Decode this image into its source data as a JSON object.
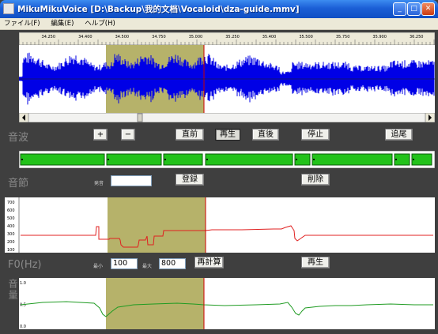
{
  "window": {
    "title": "MikuMikuVoice [D:\\Backup\\我的文档\\Vocaloid\\dza-guide.mmv]",
    "minimize": "_",
    "maximize": "□",
    "close": "✕"
  },
  "menu": [
    {
      "label": "ファイル(F)"
    },
    {
      "label": "編集(E)"
    },
    {
      "label": "ヘルプ(H)"
    }
  ],
  "ruler": {
    "ticks": [
      "34.250",
      "34.400",
      "34.500",
      "34.750",
      "35.000",
      "35.250",
      "35.400",
      "35.500",
      "35.750",
      "35.900",
      "36.250"
    ]
  },
  "colors": {
    "waveform": "#0000e6",
    "selection": "#b6b26a",
    "cursor": "#cc0000",
    "note": "#22c21a",
    "pitch": "#e02020",
    "volume": "#1f9b22"
  },
  "waveform": {
    "section_label": "音波",
    "zoom_in": "+",
    "zoom_out": "−",
    "prev": "直前",
    "play": "再生",
    "next": "直後",
    "stop": "停止",
    "end": "追尾"
  },
  "notes": {
    "section_label": "音節",
    "lyric_label": "発音",
    "lyric_value": "",
    "register": "登録",
    "delete": "削除"
  },
  "pitch": {
    "section_label": "F0(Hz)",
    "y_ticks": [
      "700",
      "600",
      "500",
      "400",
      "300",
      "200",
      "100"
    ],
    "min_label": "最小",
    "min_value": "100",
    "max_label": "最大",
    "max_value": "800",
    "recalc": "再計算",
    "play": "再生"
  },
  "volume": {
    "section_label": "音量",
    "y_ticks": [
      "1.0",
      "0.5",
      "0.0"
    ]
  }
}
